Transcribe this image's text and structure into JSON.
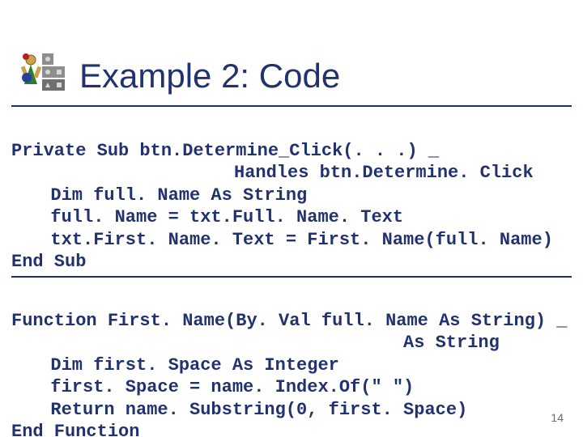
{
  "title": "Example 2: Code",
  "page_number": "14",
  "code_block_1": {
    "l1": "Private Sub btn.Determine_Click(. . .) _",
    "l2": "Handles btn.Determine. Click",
    "l3": "Dim full. Name As String",
    "l4": "full. Name = txt.Full. Name. Text",
    "l5": "txt.First. Name. Text = First. Name(full. Name)",
    "l6": "End Sub"
  },
  "code_block_2": {
    "l1": "Function First. Name(By. Val full. Name As String) _",
    "l2": "As String",
    "l3": "Dim first. Space As Integer",
    "l4": "first. Space = name. Index.Of(\" \")",
    "l5": "Return name. Substring(0, first. Space)",
    "l6": "End Function"
  }
}
